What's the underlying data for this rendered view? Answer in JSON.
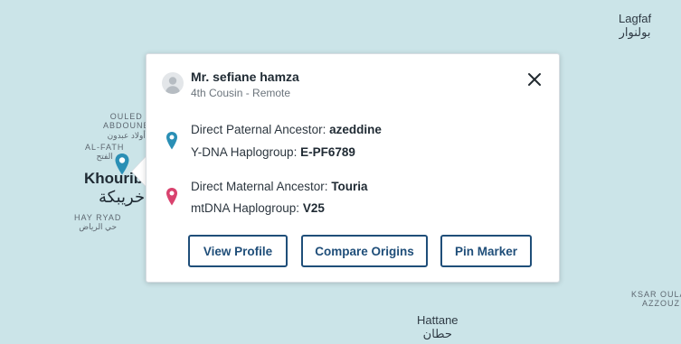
{
  "map": {
    "labels": {
      "lagfaf": "Lagfaf",
      "lagfaf_ar": "بولنوار",
      "ouled_line1": "OULED",
      "ouled_line2": "ABDOUNE",
      "ouled_ar": "أولاد عبدون",
      "al_fath": "AL-FATH",
      "al_fath_ar": "الفتح",
      "khouribga": "Khouribga",
      "khouribga_ar": "خريبكة",
      "hay_ryad": "HAY RYAD",
      "hay_ryad_ar": "حي الرياض",
      "hattane": "Hattane",
      "hattane_ar": "حطان",
      "ksar_line1": "KSAR OULA",
      "ksar_line2": "AZZOUZ"
    },
    "marker_icon": "location-pin-icon",
    "marker_color": "#2a8fb5"
  },
  "popup": {
    "name": "Mr. sefiane hamza",
    "relation": "4th Cousin - Remote",
    "paternal": {
      "label": "Direct Paternal Ancestor: ",
      "value": "azeddine",
      "haplo_label": "Y-DNA Haplogroup: ",
      "haplo_value": "E-PF6789",
      "icon": "blue-pin-icon",
      "color": "#2a8fb5"
    },
    "maternal": {
      "label": "Direct Maternal Ancestor: ",
      "value": "Touria",
      "haplo_label": "mtDNA Haplogroup: ",
      "haplo_value": "V25",
      "icon": "pink-pin-icon",
      "color": "#d9426e"
    },
    "buttons": {
      "view_profile": "View Profile",
      "compare_origins": "Compare Origins",
      "pin_marker": "Pin Marker"
    },
    "accent_color": "#1f4e79",
    "close_icon": "close-icon"
  }
}
